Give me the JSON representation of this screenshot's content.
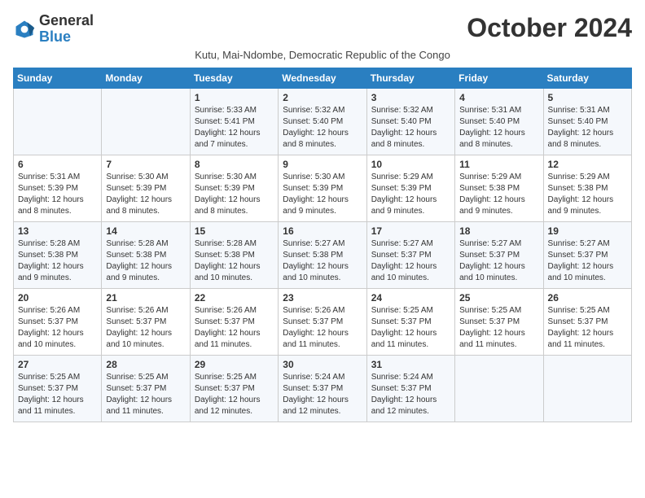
{
  "logo": {
    "general": "General",
    "blue": "Blue"
  },
  "title": "October 2024",
  "subtitle": "Kutu, Mai-Ndombe, Democratic Republic of the Congo",
  "days_of_week": [
    "Sunday",
    "Monday",
    "Tuesday",
    "Wednesday",
    "Thursday",
    "Friday",
    "Saturday"
  ],
  "weeks": [
    [
      {
        "day": "",
        "info": ""
      },
      {
        "day": "",
        "info": ""
      },
      {
        "day": "1",
        "info": "Sunrise: 5:33 AM\nSunset: 5:41 PM\nDaylight: 12 hours and 7 minutes."
      },
      {
        "day": "2",
        "info": "Sunrise: 5:32 AM\nSunset: 5:40 PM\nDaylight: 12 hours and 8 minutes."
      },
      {
        "day": "3",
        "info": "Sunrise: 5:32 AM\nSunset: 5:40 PM\nDaylight: 12 hours and 8 minutes."
      },
      {
        "day": "4",
        "info": "Sunrise: 5:31 AM\nSunset: 5:40 PM\nDaylight: 12 hours and 8 minutes."
      },
      {
        "day": "5",
        "info": "Sunrise: 5:31 AM\nSunset: 5:40 PM\nDaylight: 12 hours and 8 minutes."
      }
    ],
    [
      {
        "day": "6",
        "info": "Sunrise: 5:31 AM\nSunset: 5:39 PM\nDaylight: 12 hours and 8 minutes."
      },
      {
        "day": "7",
        "info": "Sunrise: 5:30 AM\nSunset: 5:39 PM\nDaylight: 12 hours and 8 minutes."
      },
      {
        "day": "8",
        "info": "Sunrise: 5:30 AM\nSunset: 5:39 PM\nDaylight: 12 hours and 8 minutes."
      },
      {
        "day": "9",
        "info": "Sunrise: 5:30 AM\nSunset: 5:39 PM\nDaylight: 12 hours and 9 minutes."
      },
      {
        "day": "10",
        "info": "Sunrise: 5:29 AM\nSunset: 5:39 PM\nDaylight: 12 hours and 9 minutes."
      },
      {
        "day": "11",
        "info": "Sunrise: 5:29 AM\nSunset: 5:38 PM\nDaylight: 12 hours and 9 minutes."
      },
      {
        "day": "12",
        "info": "Sunrise: 5:29 AM\nSunset: 5:38 PM\nDaylight: 12 hours and 9 minutes."
      }
    ],
    [
      {
        "day": "13",
        "info": "Sunrise: 5:28 AM\nSunset: 5:38 PM\nDaylight: 12 hours and 9 minutes."
      },
      {
        "day": "14",
        "info": "Sunrise: 5:28 AM\nSunset: 5:38 PM\nDaylight: 12 hours and 9 minutes."
      },
      {
        "day": "15",
        "info": "Sunrise: 5:28 AM\nSunset: 5:38 PM\nDaylight: 12 hours and 10 minutes."
      },
      {
        "day": "16",
        "info": "Sunrise: 5:27 AM\nSunset: 5:38 PM\nDaylight: 12 hours and 10 minutes."
      },
      {
        "day": "17",
        "info": "Sunrise: 5:27 AM\nSunset: 5:37 PM\nDaylight: 12 hours and 10 minutes."
      },
      {
        "day": "18",
        "info": "Sunrise: 5:27 AM\nSunset: 5:37 PM\nDaylight: 12 hours and 10 minutes."
      },
      {
        "day": "19",
        "info": "Sunrise: 5:27 AM\nSunset: 5:37 PM\nDaylight: 12 hours and 10 minutes."
      }
    ],
    [
      {
        "day": "20",
        "info": "Sunrise: 5:26 AM\nSunset: 5:37 PM\nDaylight: 12 hours and 10 minutes."
      },
      {
        "day": "21",
        "info": "Sunrise: 5:26 AM\nSunset: 5:37 PM\nDaylight: 12 hours and 10 minutes."
      },
      {
        "day": "22",
        "info": "Sunrise: 5:26 AM\nSunset: 5:37 PM\nDaylight: 12 hours and 11 minutes."
      },
      {
        "day": "23",
        "info": "Sunrise: 5:26 AM\nSunset: 5:37 PM\nDaylight: 12 hours and 11 minutes."
      },
      {
        "day": "24",
        "info": "Sunrise: 5:25 AM\nSunset: 5:37 PM\nDaylight: 12 hours and 11 minutes."
      },
      {
        "day": "25",
        "info": "Sunrise: 5:25 AM\nSunset: 5:37 PM\nDaylight: 12 hours and 11 minutes."
      },
      {
        "day": "26",
        "info": "Sunrise: 5:25 AM\nSunset: 5:37 PM\nDaylight: 12 hours and 11 minutes."
      }
    ],
    [
      {
        "day": "27",
        "info": "Sunrise: 5:25 AM\nSunset: 5:37 PM\nDaylight: 12 hours and 11 minutes."
      },
      {
        "day": "28",
        "info": "Sunrise: 5:25 AM\nSunset: 5:37 PM\nDaylight: 12 hours and 11 minutes."
      },
      {
        "day": "29",
        "info": "Sunrise: 5:25 AM\nSunset: 5:37 PM\nDaylight: 12 hours and 12 minutes."
      },
      {
        "day": "30",
        "info": "Sunrise: 5:24 AM\nSunset: 5:37 PM\nDaylight: 12 hours and 12 minutes."
      },
      {
        "day": "31",
        "info": "Sunrise: 5:24 AM\nSunset: 5:37 PM\nDaylight: 12 hours and 12 minutes."
      },
      {
        "day": "",
        "info": ""
      },
      {
        "day": "",
        "info": ""
      }
    ]
  ]
}
